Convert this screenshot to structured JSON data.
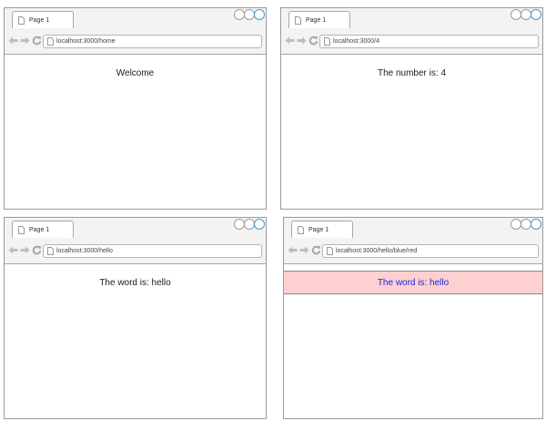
{
  "windows": [
    {
      "tab_title": "Page 1",
      "url": "localhost:3000/home",
      "content_text": "Welcome"
    },
    {
      "tab_title": "Page 1",
      "url": "localhost:3000/4",
      "content_text": "The number is: 4"
    },
    {
      "tab_title": "Page 1",
      "url": "localhost:3000/hello",
      "content_text": "The word is: hello"
    },
    {
      "tab_title": "Page 1",
      "url": "localhost:3000/hello/blue/red",
      "content_text": "The word is: hello",
      "text_color": "#2323e0",
      "background_color": "#ffd0d0"
    }
  ],
  "icons": {
    "page": "page-icon",
    "back": "back-arrow-icon",
    "forward": "forward-arrow-icon",
    "reload": "reload-icon"
  }
}
